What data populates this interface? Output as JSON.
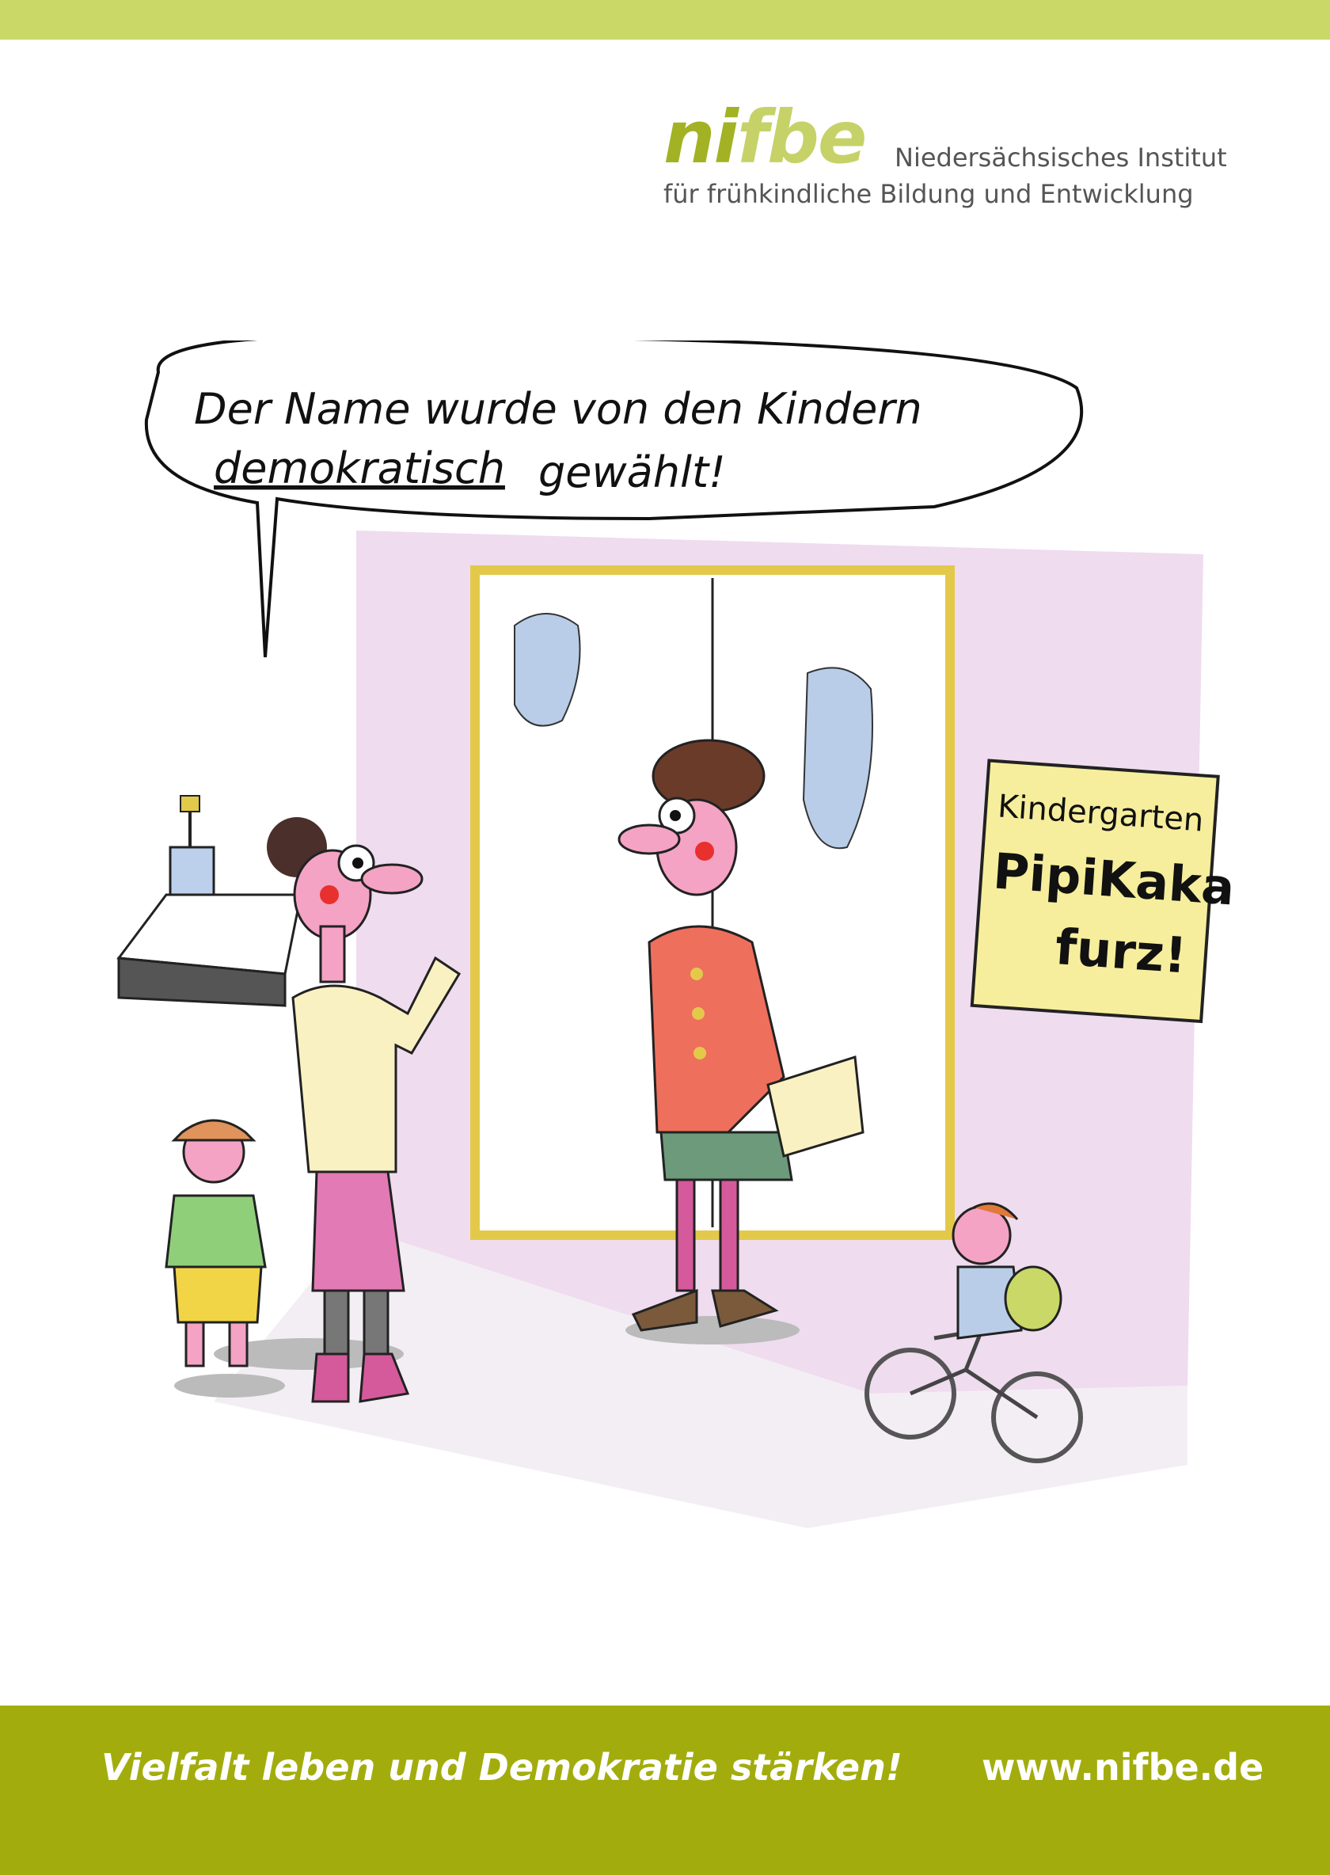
{
  "header": {
    "logo_word_part1": "ni",
    "logo_word_part2": "fbe",
    "institute_line1": "Niedersächsisches Institut",
    "institute_line2": "für frühkindliche Bildung und Entwicklung"
  },
  "cartoon": {
    "speech_line1": "Der Name wurde von den Kindern",
    "speech_line2_part1": "demokratisch",
    "speech_line2_part2": "gewählt!",
    "sign_line1": "Kindergarten",
    "sign_line2": "PipiKaka-",
    "sign_line3": "furz!"
  },
  "footer": {
    "slogan": "Vielfalt leben und Demokratie stärken!",
    "website": "www.nifbe.de"
  },
  "colors": {
    "top_bar": "#c9d866",
    "bottom_bar": "#a2ad0d",
    "logo_primary": "#a2b224",
    "logo_secondary": "#c6d268"
  }
}
